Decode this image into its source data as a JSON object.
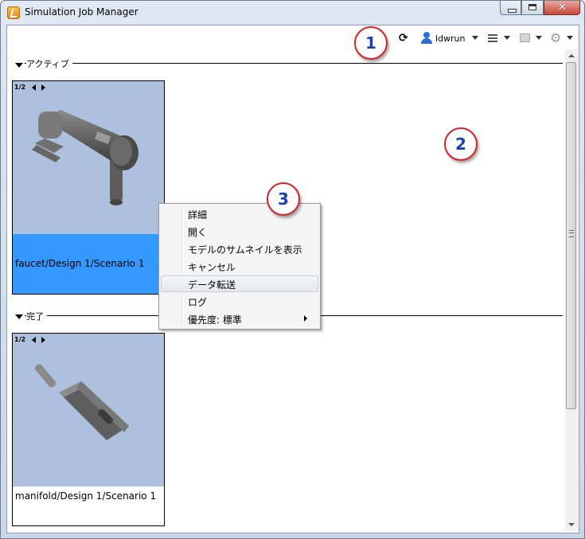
{
  "window": {
    "title": "Simulation Job Manager",
    "controls": {
      "minimize": "minimize-icon",
      "maximize": "maximize-icon",
      "close": "close-icon"
    }
  },
  "toolbar": {
    "user": "ldwrun",
    "icons": [
      "refresh-icon",
      "user-icon",
      "list-view-icon",
      "layout-icon",
      "gear-icon"
    ]
  },
  "sections": [
    {
      "label": "アクティブ",
      "jobs": [
        {
          "pager": "1/2",
          "caption": "faucet/Design 1/Scenario 1",
          "selected": true
        }
      ]
    },
    {
      "label": "完了",
      "jobs": [
        {
          "pager": "1/2",
          "caption": "manifold/Design 1/Scenario 1",
          "selected": false
        }
      ]
    }
  ],
  "context_menu": {
    "items": [
      {
        "label": "詳細"
      },
      {
        "label": "開く"
      },
      {
        "label": "モデルのサムネイルを表示"
      },
      {
        "label": "キャンセル"
      },
      {
        "label": "データ転送",
        "highlighted": true
      },
      {
        "label": "ログ"
      },
      {
        "label": "優先度: 標準",
        "submenu": true
      }
    ]
  },
  "callouts": [
    "1",
    "2",
    "3"
  ],
  "colors": {
    "selection": "#3399ff",
    "thumbnail_bg": "#adc1de",
    "callout_ring": "#d8222a",
    "callout_text": "#1c3fb0"
  }
}
